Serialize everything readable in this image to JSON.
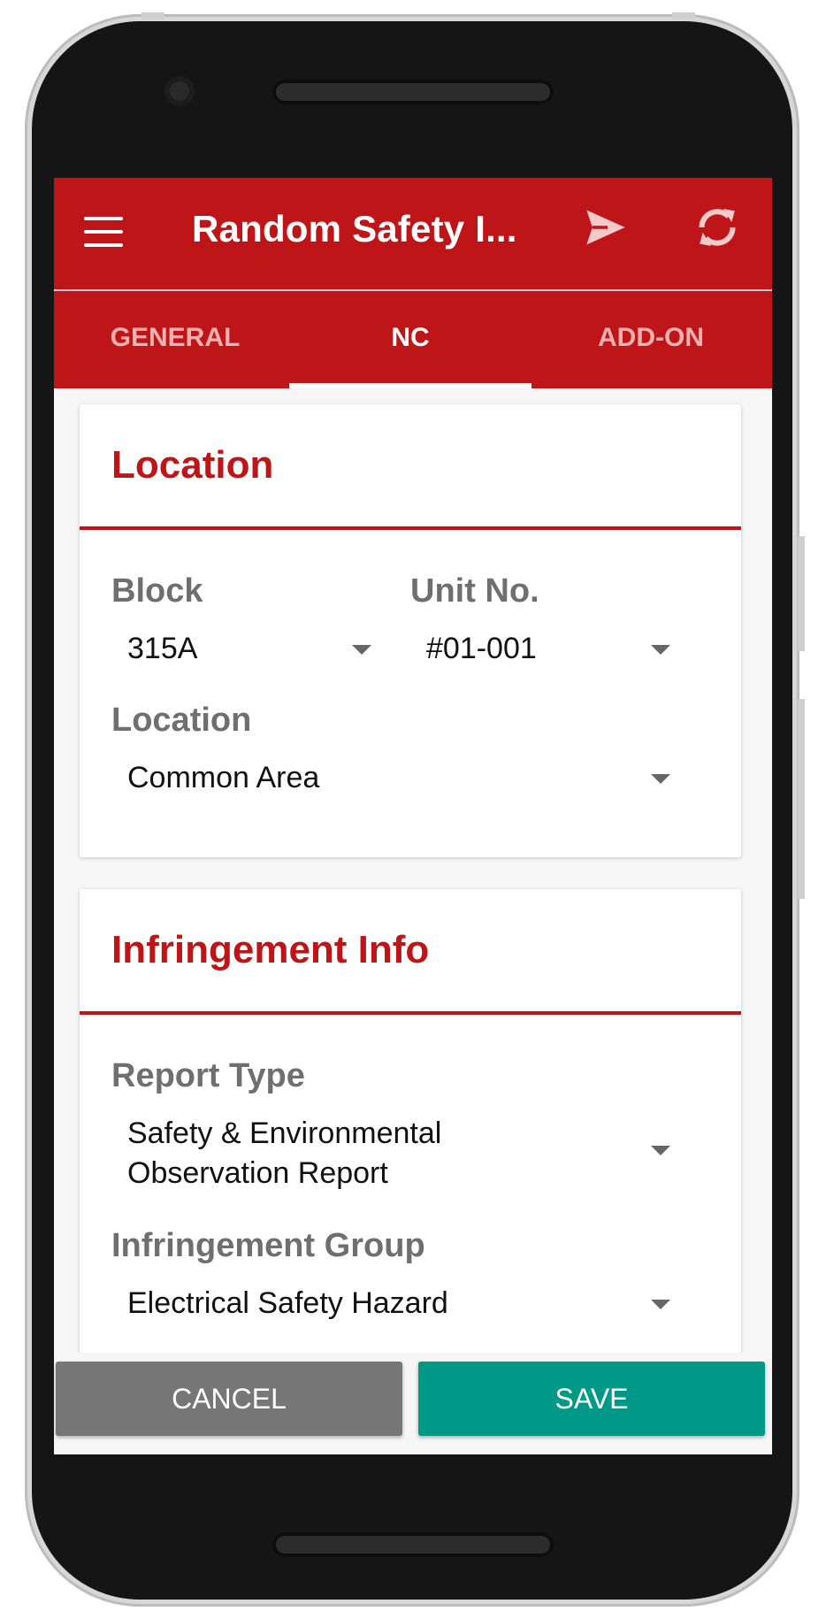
{
  "app_bar": {
    "title": "Random Safety I...",
    "menu_icon": "hamburger-menu-icon",
    "send_icon": "send-icon",
    "sync_icon": "sync-icon"
  },
  "tabs": [
    {
      "label": "GENERAL",
      "active": false
    },
    {
      "label": "NC",
      "active": true
    },
    {
      "label": "ADD-ON",
      "active": false
    }
  ],
  "location_card": {
    "title": "Location",
    "block": {
      "label": "Block",
      "value": "315A"
    },
    "unit": {
      "label": "Unit No.",
      "value": "#01-001"
    },
    "location": {
      "label": "Location",
      "value": "Common Area"
    }
  },
  "infringement_card": {
    "title": "Infringement Info",
    "report_type": {
      "label": "Report Type",
      "value_line1": "Safety & Environmental",
      "value_line2": "Observation Report"
    },
    "infringement_group": {
      "label": "Infringement Group",
      "value": "Electrical Safety Hazard"
    }
  },
  "actions": {
    "cancel_label": "CANCEL",
    "save_label": "SAVE"
  },
  "colors": {
    "primary": "#be1618",
    "save": "#009886",
    "cancel": "#777777"
  }
}
